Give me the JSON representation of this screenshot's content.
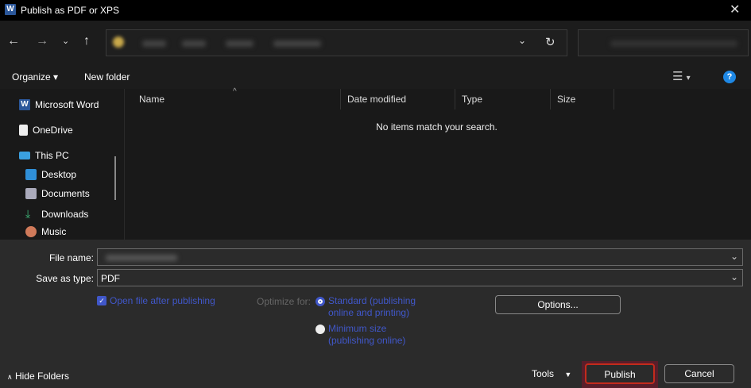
{
  "title": "Publish as PDF or XPS",
  "toolbar": {
    "organize": "Organize",
    "new_folder": "New folder"
  },
  "sidebar": {
    "items": [
      {
        "label": "Microsoft Word"
      },
      {
        "label": "OneDrive"
      },
      {
        "label": "This PC"
      },
      {
        "label": "Desktop"
      },
      {
        "label": "Documents"
      },
      {
        "label": "Downloads"
      },
      {
        "label": "Music"
      }
    ]
  },
  "columns": [
    "Name",
    "Date modified",
    "Type",
    "Size"
  ],
  "empty_message": "No items match your search.",
  "form": {
    "file_name_label": "File name:",
    "save_type_label": "Save as type:",
    "save_type_value": "PDF",
    "open_after": "Open file after publishing",
    "open_after_checked": true,
    "optimize_label": "Optimize for:",
    "standard_line1": "Standard (publishing",
    "standard_line2": "online and printing)",
    "minimum_line1": "Minimum size",
    "minimum_line2": "(publishing online)",
    "selected_optimize": "standard",
    "options": "Options..."
  },
  "footer": {
    "hide_folders": "Hide Folders",
    "tools": "Tools",
    "publish": "Publish",
    "cancel": "Cancel"
  },
  "colors": {
    "accent": "#4057c9",
    "publish_border": "#c42b1c"
  }
}
